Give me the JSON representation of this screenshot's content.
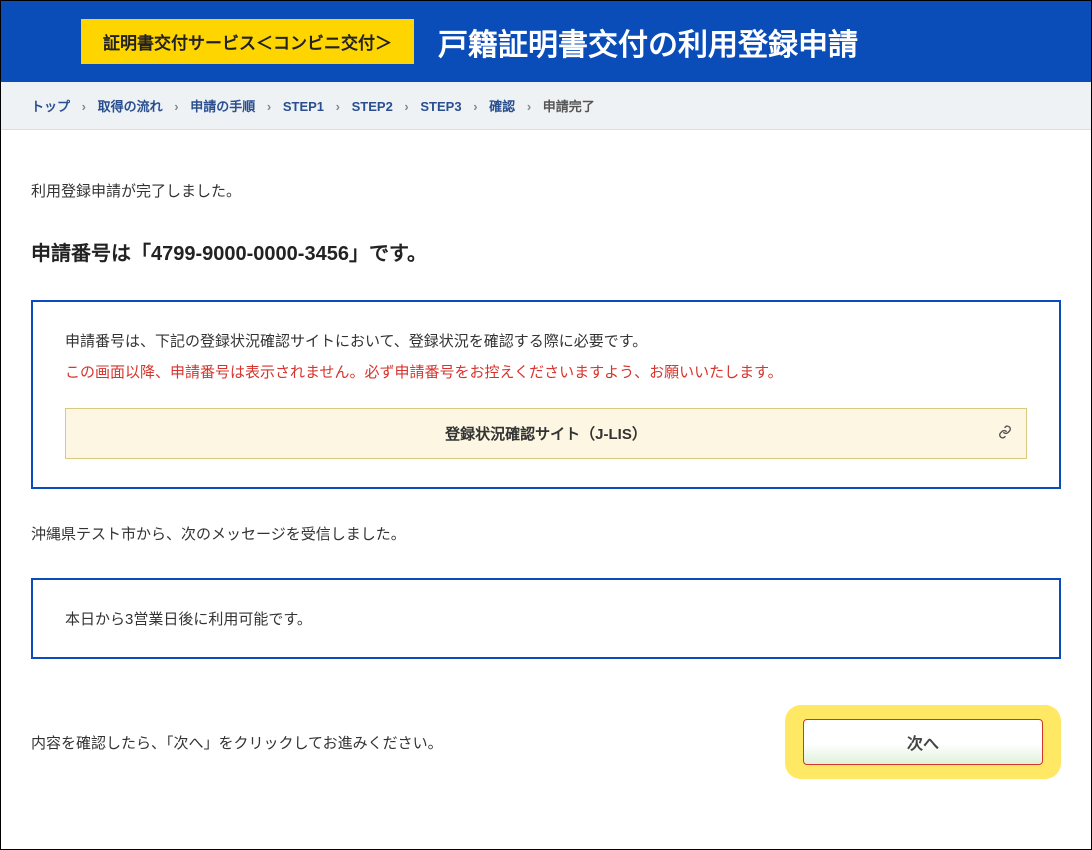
{
  "header": {
    "badge": "証明書交付サービス＜コンビニ交付＞",
    "title": "戸籍証明書交付の利用登録申請"
  },
  "breadcrumb": {
    "items": [
      {
        "label": "トップ",
        "link": true
      },
      {
        "label": "取得の流れ",
        "link": true
      },
      {
        "label": "申請の手順",
        "link": true
      },
      {
        "label": "STEP1",
        "link": true
      },
      {
        "label": "STEP2",
        "link": true
      },
      {
        "label": "STEP3",
        "link": true
      },
      {
        "label": "確認",
        "link": true
      },
      {
        "label": "申請完了",
        "link": false
      }
    ]
  },
  "main": {
    "completion_text": "利用登録申請が完了しました。",
    "app_number_line": "申請番号は「4799-9000-0000-3456」です。",
    "info": {
      "line1": "申請番号は、下記の登録状況確認サイトにおいて、登録状況を確認する際に必要です。",
      "line2": "この画面以降、申請番号は表示されません。必ず申請番号をお控えくださいますよう、お願いいたします。",
      "link_label": "登録状況確認サイト（J-LIS）"
    },
    "message_intro": "沖縄県テスト市から、次のメッセージを受信しました。",
    "message_body": "本日から3営業日後に利用可能です。",
    "footer_text": "内容を確認したら、「次へ」をクリックしてお進みください。",
    "next_label": "次へ"
  }
}
